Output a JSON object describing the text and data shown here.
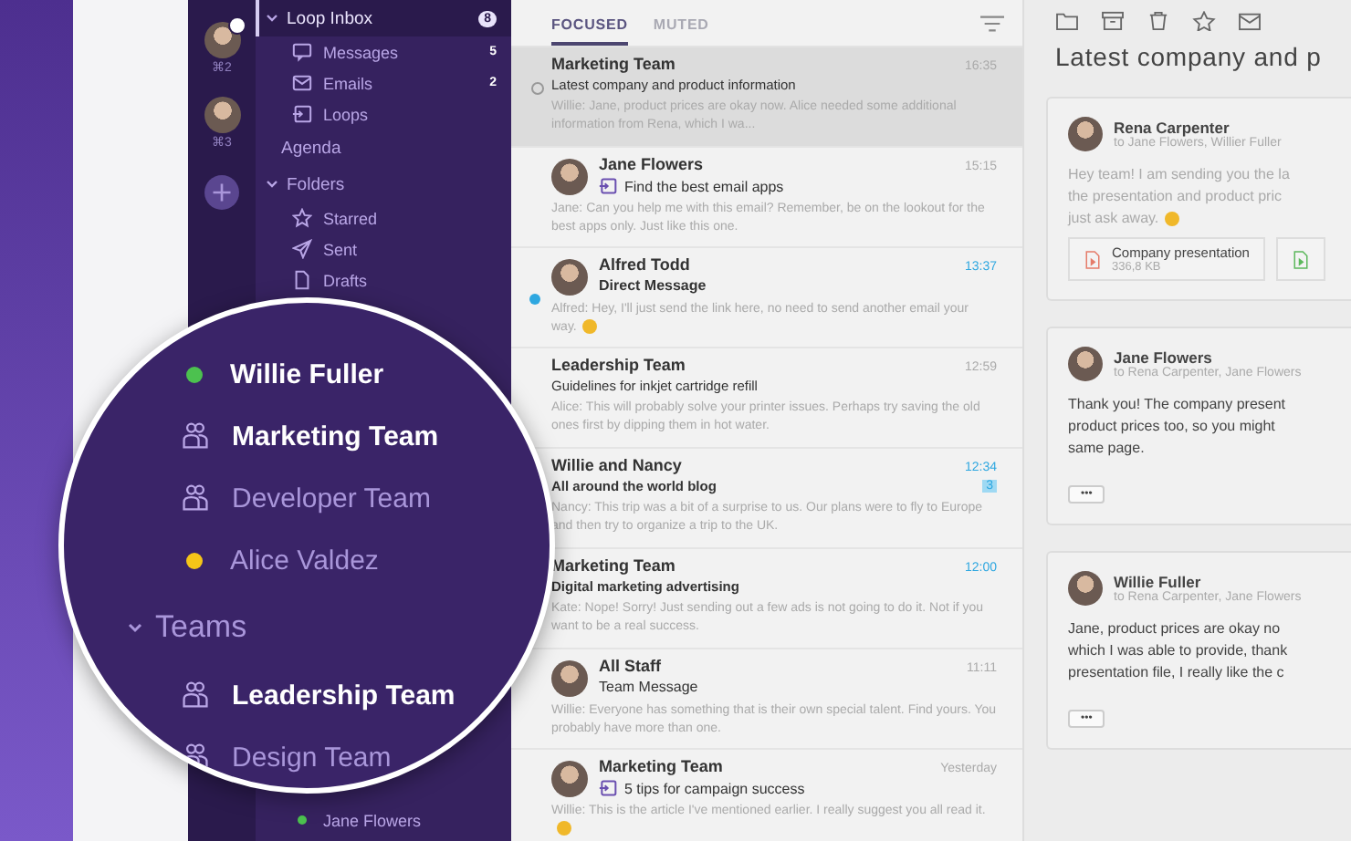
{
  "accounts": [
    {
      "shortcut": "⌘2",
      "badge": true
    },
    {
      "shortcut": "⌘3",
      "badge": false
    }
  ],
  "sidebar": {
    "items": [
      {
        "kind": "group",
        "label": "Loop Inbox",
        "count": "8",
        "selected": true,
        "expanded": true
      },
      {
        "kind": "child",
        "label": "Messages",
        "count": "5",
        "selected": false
      },
      {
        "kind": "child",
        "label": "Emails",
        "count": "2",
        "selected": false
      },
      {
        "kind": "child",
        "label": "Loops",
        "selected": false
      },
      {
        "kind": "link",
        "label": "Agenda",
        "selected": false
      },
      {
        "kind": "group",
        "label": "Folders",
        "selected": false,
        "expanded": true
      },
      {
        "kind": "child",
        "label": "Starred",
        "selected": false
      },
      {
        "kind": "child",
        "label": "Sent",
        "selected": false
      },
      {
        "kind": "child",
        "label": "Drafts",
        "selected": false
      }
    ],
    "bottom": [
      {
        "label": "Jane Flowers",
        "color": "#4cc14f"
      }
    ]
  },
  "magnifier": {
    "items": [
      {
        "kind": "person",
        "label": "Willie Fuller",
        "color": "#4cc14f",
        "unread": true
      },
      {
        "kind": "team",
        "label": "Marketing Team",
        "unread": true
      },
      {
        "kind": "team",
        "label": "Developer Team",
        "unread": false
      },
      {
        "kind": "person",
        "label": "Alice Valdez",
        "color": "#f5c518",
        "unread": false
      },
      {
        "kind": "section",
        "label": "Teams",
        "expanded": true
      },
      {
        "kind": "team",
        "label": "Leadership Team",
        "unread": true
      },
      {
        "kind": "team",
        "label": "Design Team",
        "unread": false
      }
    ]
  },
  "tabs": [
    {
      "label": "FOCUSED",
      "selected": true
    },
    {
      "label": "MUTED",
      "selected": false
    }
  ],
  "messages": [
    {
      "sender": "Marketing Team",
      "subject": "Latest company and product information",
      "preview": "Willie: Jane, product prices are okay now. Alice needed some additional information from Rena, which I wa...",
      "time": "16:35",
      "avatar": false,
      "unread": false,
      "selected": true,
      "ring": true
    },
    {
      "sender": "Jane Flowers",
      "subject": "Find the best email apps",
      "preview": "Jane: Can you help me with this email? Remember, be on the lookout for the best apps only. Just like this one.",
      "time": "15:15",
      "avatar": true,
      "unread": false,
      "selected": false,
      "loop": true
    },
    {
      "sender": "Alfred Todd",
      "subject": "Direct Message",
      "preview": "Alfred: Hey, I'll just send the link here, no need to send another email your way.",
      "time": "13:37",
      "avatar": true,
      "unread": true,
      "selected": false,
      "dot": true,
      "emoji": true
    },
    {
      "sender": "Leadership Team",
      "subject": "Guidelines for inkjet cartridge refill",
      "preview": "Alice: This will probably solve your printer issues. Perhaps try saving the old ones first by dipping them in hot water.",
      "time": "12:59",
      "avatar": false,
      "unread": false,
      "selected": false
    },
    {
      "sender": "Willie and Nancy",
      "subject": "All around the world blog",
      "preview": "Nancy: This trip was a bit of a surprise to us. Our plans were to fly to Europe and then try to organize a trip to the UK.",
      "time": "12:34",
      "avatar": false,
      "unread": true,
      "selected": false,
      "badge": "3"
    },
    {
      "sender": "Marketing Team",
      "subject": "Digital marketing advertising",
      "preview": "Kate: Nope! Sorry! Just sending out a few ads is not going to do it. Not if you want to be a real success.",
      "time": "12:00",
      "avatar": false,
      "unread": true,
      "selected": false
    },
    {
      "sender": "All Staff",
      "subject": "Team Message",
      "preview": "Willie: Everyone has something that is their own special talent. Find yours. You probably have more than one.",
      "time": "11:11",
      "avatar": true,
      "unread": false,
      "selected": false
    },
    {
      "sender": "Marketing Team",
      "subject": "5 tips for campaign success",
      "preview": "Willie: This is the article I've mentioned earlier. I really suggest you all read it.",
      "time": "Yesterday",
      "avatar": true,
      "unread": false,
      "selected": false,
      "loop": true,
      "emoji": true
    }
  ],
  "detail": {
    "title": "Latest company and p",
    "cards": [
      {
        "sender": "Rena Carpenter",
        "recipients": "to Jane Flowers, Willier Fuller",
        "dimmed": true,
        "lines": [
          "Hey team! I am sending you the la",
          "the presentation and product pric",
          "just ask away."
        ],
        "emoji": true,
        "attachments": [
          {
            "name": "Company presentation",
            "size": "336,8 KB",
            "color": "#e57c6a"
          },
          {
            "color": "#5cb85c"
          }
        ]
      },
      {
        "sender": "Jane Flowers",
        "recipients": "to Rena Carpenter, Jane Flowers",
        "dimmed": false,
        "lines": [
          "Thank you! The company present",
          "product prices too, so you might",
          "same page."
        ],
        "more": "•••"
      },
      {
        "sender": "Willie Fuller",
        "recipients": "to Rena Carpenter, Jane Flowers",
        "dimmed": false,
        "lines": [
          "Jane, product prices are okay no",
          "which I was able to provide, thank",
          "presentation file, I really like the c"
        ],
        "more": "•••"
      }
    ]
  }
}
